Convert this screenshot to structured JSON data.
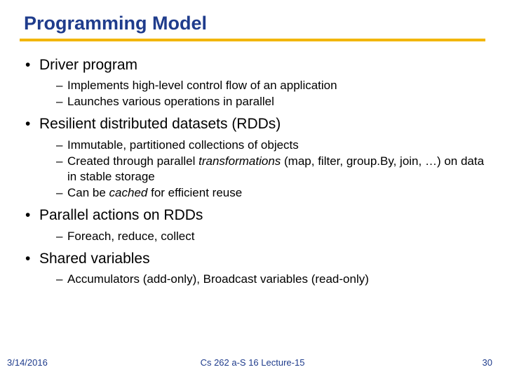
{
  "title": "Programming Model",
  "bullets": [
    {
      "text": "Driver program",
      "sub": [
        {
          "html": "Implements high-level control flow of an application"
        },
        {
          "html": "Launches various operations in parallel"
        }
      ]
    },
    {
      "text": "Resilient distributed datasets (RDDs)",
      "sub": [
        {
          "html": "Immutable, partitioned collections of objects"
        },
        {
          "html": "Created through parallel <em>transformations</em> (map, filter, group.By, join, …) on data in stable storage"
        },
        {
          "html": "Can be <em>cached</em> for efficient reuse"
        }
      ]
    },
    {
      "text": "Parallel actions on RDDs",
      "sub": [
        {
          "html": "Foreach, reduce, collect"
        }
      ]
    },
    {
      "text": "Shared variables",
      "sub": [
        {
          "html": "Accumulators (add-only), Broadcast variables (read-only)"
        }
      ]
    }
  ],
  "footer": {
    "date": "3/14/2016",
    "center": "Cs 262 a-S 16 Lecture-15",
    "page": "30"
  }
}
